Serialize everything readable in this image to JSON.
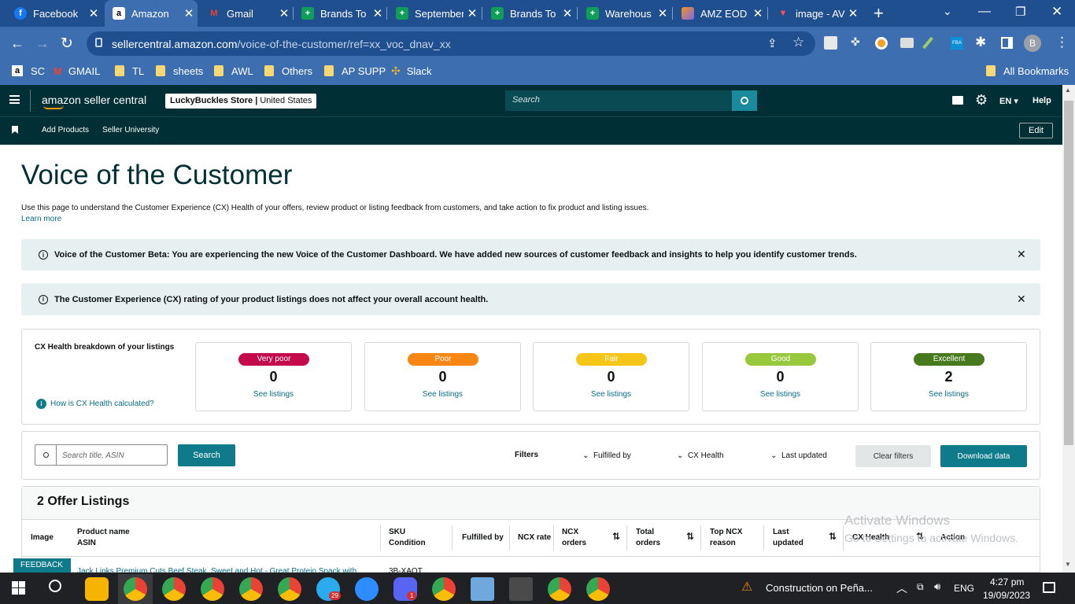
{
  "browser": {
    "tabs": [
      {
        "label": "Facebook",
        "icon": "facebook-icon",
        "color": "#1877f2"
      },
      {
        "label": "Amazon",
        "icon": "amazon-icon",
        "color": "#ffffff",
        "active": true
      },
      {
        "label": "Gmail",
        "icon": "gmail-icon",
        "color": "#ea4335"
      },
      {
        "label": "Brands To",
        "icon": "sheets-icon",
        "color": "#0f9d58"
      },
      {
        "label": "September",
        "icon": "sheets-icon",
        "color": "#0f9d58"
      },
      {
        "label": "Brands To",
        "icon": "sheets-icon",
        "color": "#0f9d58"
      },
      {
        "label": "Warehous",
        "icon": "sheets-icon",
        "color": "#0f9d58"
      },
      {
        "label": "AMZ EOD",
        "icon": "clickup-icon",
        "color": "#f7931a"
      },
      {
        "label": "image - AV",
        "icon": "image-icon",
        "color": "#d93025"
      }
    ],
    "url_host": "sellercentral.amazon.com",
    "url_path": "/voice-of-the-customer/ref=xx_voc_dnav_xx",
    "profile_initial": "B",
    "bookmarks": [
      "SC",
      "GMAIL",
      "TL",
      "sheets",
      "AWL",
      "Others",
      "AP SUPP",
      "Slack"
    ],
    "all_bookmarks": "All Bookmarks"
  },
  "seller_central": {
    "logo": "amazon seller central",
    "store": "LuckyBuckles Store",
    "marketplace": "United States",
    "search_placeholder": "Search",
    "language": "EN",
    "help": "Help",
    "nav": [
      "Add Products",
      "Seller University"
    ],
    "edit": "Edit"
  },
  "page": {
    "title": "Voice of the Customer",
    "description": "Use this page to understand the Customer Experience (CX) Health of your offers, review product or listing feedback from customers, and take action to fix product and listing issues.",
    "learn_more": "Learn more",
    "alert1": "Voice of the Customer Beta: You are experiencing the new Voice of the Customer Dashboard. We have added new sources of customer feedback and insights to help you identify customer trends.",
    "alert2": "The Customer Experience (CX) rating of your product listings does not affect your overall account health."
  },
  "cx_health": {
    "heading": "CX Health breakdown of your listings",
    "how_link": "How is CX Health calculated?",
    "buckets": [
      {
        "label": "Very poor",
        "count": "0",
        "link": "See listings",
        "color": "#c40a4a"
      },
      {
        "label": "Poor",
        "count": "0",
        "link": "See listings",
        "color": "#f98612"
      },
      {
        "label": "Fair",
        "count": "0",
        "link": "See listings",
        "color": "#f5c518"
      },
      {
        "label": "Good",
        "count": "0",
        "link": "See listings",
        "color": "#98c93c"
      },
      {
        "label": "Excellent",
        "count": "2",
        "link": "See listings",
        "color": "#477a1e"
      }
    ]
  },
  "filters": {
    "search_placeholder": "Search title, ASIN",
    "search_button": "Search",
    "label": "Filters",
    "fulfilled_by": "Fulfilled by",
    "cx_health": "CX Health",
    "last_updated": "Last updated",
    "clear": "Clear filters",
    "download": "Download data"
  },
  "listings": {
    "heading": "2 Offer Listings",
    "columns": {
      "image": "Image",
      "product_name": "Product name",
      "asin": "ASIN",
      "sku": "SKU",
      "condition": "Condition",
      "fulfilled_by": "Fulfilled by",
      "ncx_rate": "NCX rate",
      "ncx_orders_1": "NCX",
      "ncx_orders_2": "orders",
      "total_1": "Total",
      "total_2": "orders",
      "top_1": "Top NCX",
      "top_2": "reason",
      "last_1": "Last",
      "last_2": "updated",
      "cx_health": "CX Health",
      "action": "Action"
    },
    "row1_name": "Jack Links Premium Cuts Beef Steak, Sweet and Hot - Great Protein Snack with",
    "row1_sku": "3B-XAQT"
  },
  "feedback": "FEEDBACK",
  "watermark": {
    "line1": "Activate Windows",
    "line2": "Go to Settings to activate Windows."
  },
  "taskbar": {
    "weather": "Construction on Peña...",
    "language": "ENG",
    "time": "4:27 pm",
    "date": "19/09/2023",
    "badge_telegram": "29",
    "badge_discord": "1"
  }
}
